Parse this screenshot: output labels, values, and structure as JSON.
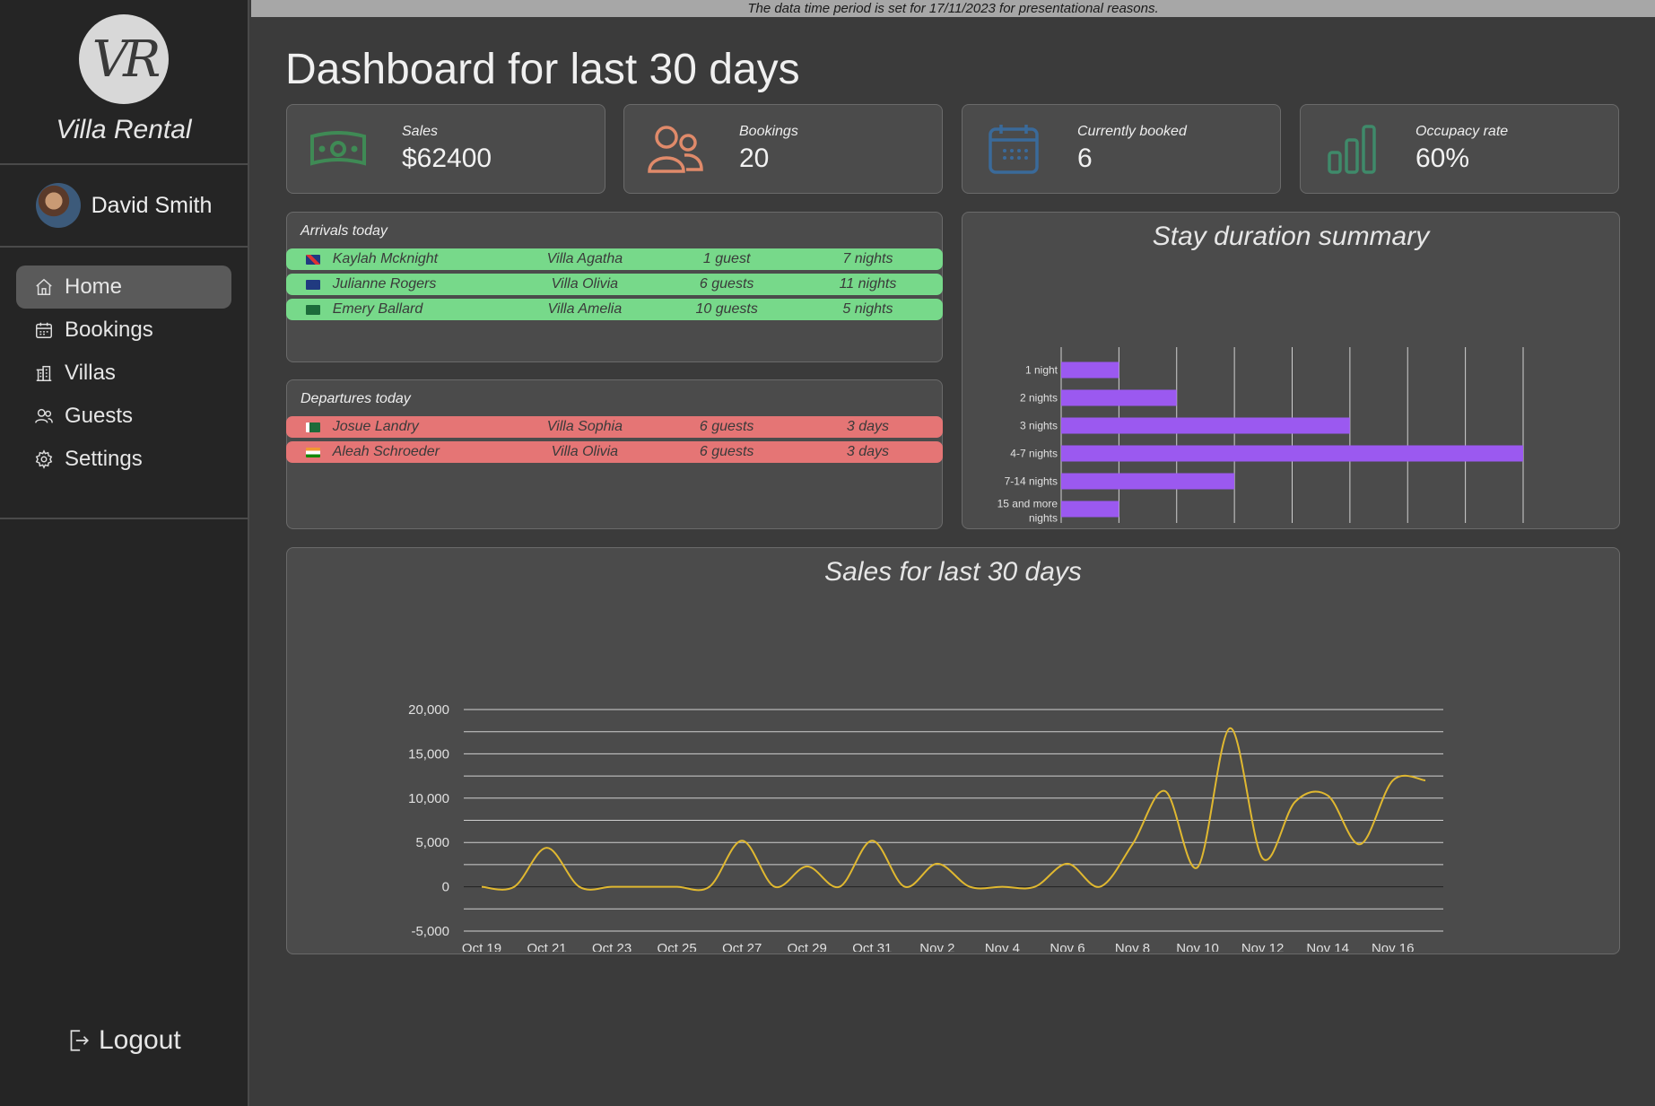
{
  "banner": "The data time period is set for 17/11/2023 for presentational reasons.",
  "sidebar": {
    "logo_text": "VR",
    "brand": "Villa Rental",
    "user_name": "David Smith",
    "nav": [
      {
        "label": "Home",
        "icon": "home-icon",
        "active": true
      },
      {
        "label": "Bookings",
        "icon": "calendar-icon",
        "active": false
      },
      {
        "label": "Villas",
        "icon": "building-icon",
        "active": false
      },
      {
        "label": "Guests",
        "icon": "users-icon",
        "active": false
      },
      {
        "label": "Settings",
        "icon": "gear-icon",
        "active": false
      }
    ],
    "logout": "Logout"
  },
  "page_title": "Dashboard for last 30 days",
  "stats": [
    {
      "label": "Sales",
      "value": "$62400",
      "icon": "banknote-icon",
      "color": "#3f8a55"
    },
    {
      "label": "Bookings",
      "value": "20",
      "icon": "users-icon",
      "color": "#e08a6a"
    },
    {
      "label": "Currently booked",
      "value": "6",
      "icon": "calendar-icon",
      "color": "#3a6a9a"
    },
    {
      "label": "Occupacy rate",
      "value": "60%",
      "icon": "bar-chart-icon",
      "color": "#3f8a6a"
    }
  ],
  "arrivals": {
    "title": "Arrivals today",
    "rows": [
      {
        "flag": "uk",
        "name": "Kaylah Mcknight",
        "villa": "Villa Agatha",
        "guests": "1 guest",
        "nights": "7 nights"
      },
      {
        "flag": "au",
        "name": "Julianne Rogers",
        "villa": "Villa Olivia",
        "guests": "6 guests",
        "nights": "11 nights"
      },
      {
        "flag": "sa",
        "name": "Emery Ballard",
        "villa": "Villa Amelia",
        "guests": "10 guests",
        "nights": "5 nights"
      }
    ]
  },
  "departures": {
    "title": "Departures today",
    "rows": [
      {
        "flag": "pk",
        "name": "Josue Landry",
        "villa": "Villa Sophia",
        "guests": "6 guests",
        "nights": "3 days"
      },
      {
        "flag": "in",
        "name": "Aleah Schroeder",
        "villa": "Villa Olivia",
        "guests": "6 guests",
        "nights": "3 days"
      }
    ]
  },
  "colors": {
    "arrival_row": "#77d98a",
    "departure_row": "#e57575",
    "bar": "#9b59f0",
    "line": "#e0b830"
  },
  "chart_data": [
    {
      "type": "bar",
      "orientation": "horizontal",
      "title": "Stay duration summary",
      "categories": [
        "1 night",
        "2 nights",
        "3 nights",
        "4-7 nights",
        "7-14 nights",
        "15 and more nights"
      ],
      "values": [
        1,
        2,
        5,
        8,
        3,
        1
      ],
      "xlim": [
        0,
        8
      ],
      "xticks": [
        "0",
        "2",
        "4",
        "6",
        "8"
      ],
      "grid": true
    },
    {
      "type": "line",
      "title": "Sales for last 30 days",
      "x": [
        "Oct 19",
        "Oct 20",
        "Oct 21",
        "Oct 22",
        "Oct 23",
        "Oct 24",
        "Oct 25",
        "Oct 26",
        "Oct 27",
        "Oct 28",
        "Oct 29",
        "Oct 30",
        "Oct 31",
        "Nov 1",
        "Nov 2",
        "Nov 3",
        "Nov 4",
        "Nov 5",
        "Nov 6",
        "Nov 7",
        "Nov 8",
        "Nov 9",
        "Nov 10",
        "Nov 11",
        "Nov 12",
        "Nov 13",
        "Nov 14",
        "Nov 15",
        "Nov 16",
        "Nov 17"
      ],
      "values": [
        0,
        0,
        4400,
        0,
        0,
        0,
        0,
        0,
        5200,
        0,
        2300,
        0,
        5200,
        0,
        2600,
        0,
        0,
        0,
        2600,
        0,
        4800,
        10800,
        2200,
        17900,
        3200,
        9600,
        10300,
        4800,
        12000,
        12000
      ],
      "ylim": [
        -5000,
        20000
      ],
      "yticks": [
        "-5,000",
        "0",
        "5,000",
        "10,000",
        "15,000",
        "20,000"
      ],
      "grid": true
    }
  ]
}
